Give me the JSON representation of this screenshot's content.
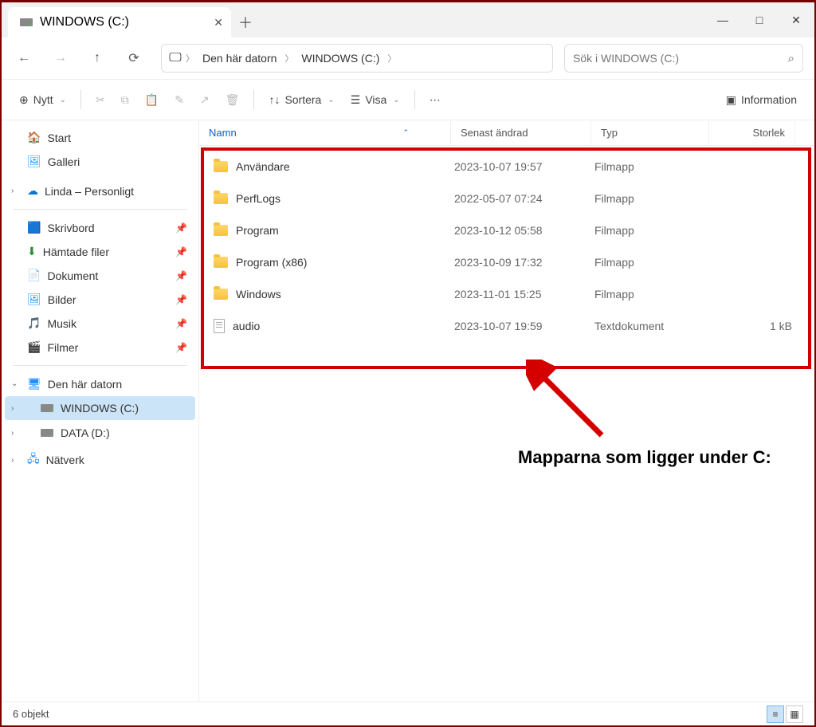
{
  "window": {
    "tab_title": "WINDOWS (C:)",
    "minimize": "—",
    "maximize": "□",
    "close": "✕"
  },
  "nav": {
    "breadcrumb": [
      "Den här datorn",
      "WINDOWS (C:)"
    ],
    "search_placeholder": "Sök i WINDOWS (C:)"
  },
  "toolbar": {
    "new_label": "Nytt",
    "sort_label": "Sortera",
    "view_label": "Visa",
    "details_label": "Information"
  },
  "sidebar": {
    "start": "Start",
    "galleri": "Galleri",
    "onedrive": "Linda – Personligt",
    "quick": [
      {
        "label": "Skrivbord"
      },
      {
        "label": "Hämtade filer"
      },
      {
        "label": "Dokument"
      },
      {
        "label": "Bilder"
      },
      {
        "label": "Musik"
      },
      {
        "label": "Filmer"
      }
    ],
    "thispc": "Den här datorn",
    "drives": [
      {
        "label": "WINDOWS (C:)"
      },
      {
        "label": "DATA (D:)"
      }
    ],
    "network": "Nätverk"
  },
  "columns": {
    "name": "Namn",
    "date": "Senast ändrad",
    "type": "Typ",
    "size": "Storlek"
  },
  "files": [
    {
      "name": "Användare",
      "date": "2023-10-07 19:57",
      "type": "Filmapp",
      "size": "",
      "icon": "folder"
    },
    {
      "name": "PerfLogs",
      "date": "2022-05-07 07:24",
      "type": "Filmapp",
      "size": "",
      "icon": "folder"
    },
    {
      "name": "Program",
      "date": "2023-10-12 05:58",
      "type": "Filmapp",
      "size": "",
      "icon": "folder"
    },
    {
      "name": "Program (x86)",
      "date": "2023-10-09 17:32",
      "type": "Filmapp",
      "size": "",
      "icon": "folder"
    },
    {
      "name": "Windows",
      "date": "2023-11-01 15:25",
      "type": "Filmapp",
      "size": "",
      "icon": "folder"
    },
    {
      "name": "audio",
      "date": "2023-10-07 19:59",
      "type": "Textdokument",
      "size": "1 kB",
      "icon": "doc"
    }
  ],
  "annotation": {
    "text": "Mapparna som ligger under C:"
  },
  "status": {
    "count_label": "6 objekt"
  }
}
